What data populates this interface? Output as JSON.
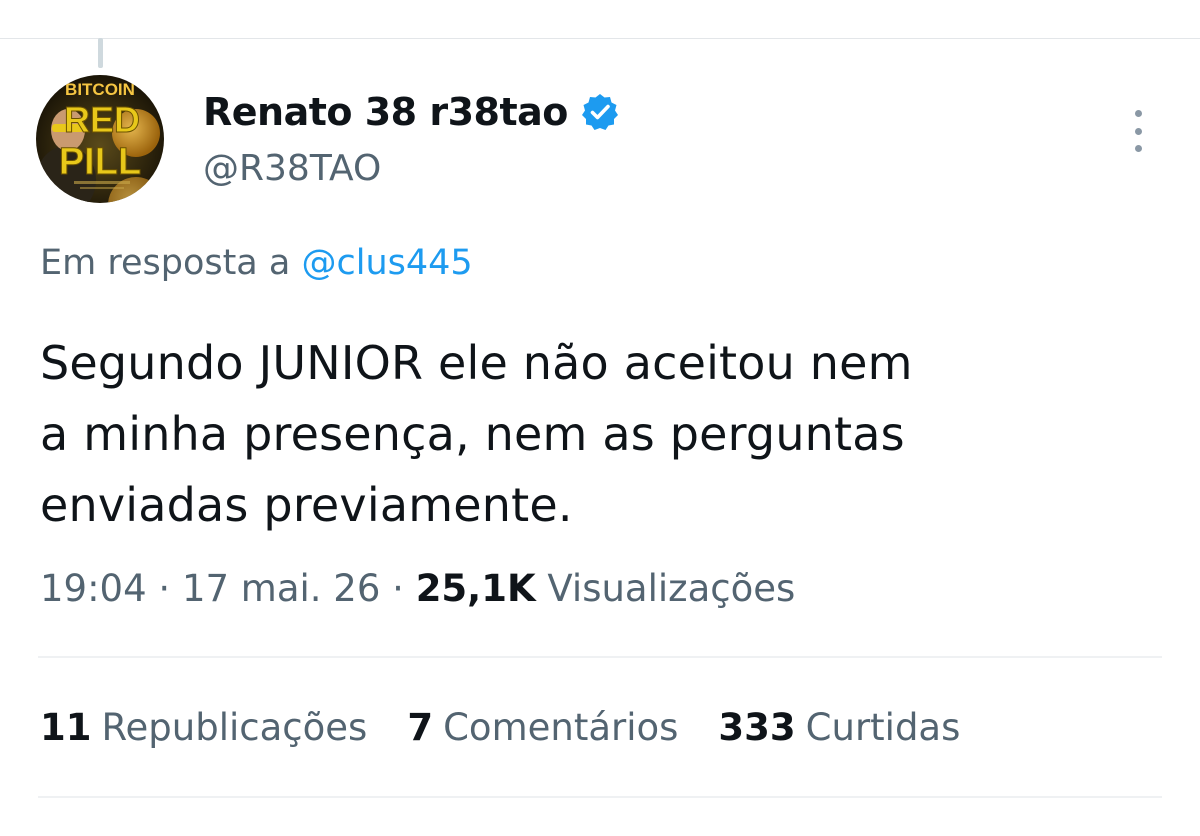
{
  "author": {
    "display_name": "Renato 38 r38tao",
    "handle": "@R38TAO",
    "verified": true,
    "avatar_text": [
      "BITCOIN",
      "RED",
      "PILL"
    ]
  },
  "more_icon": "more-vertical-icon",
  "reply": {
    "prefix": "Em resposta a",
    "mention": "@clus445"
  },
  "tweet": {
    "lines": [
      "Segundo JUNIOR ele não aceitou nem",
      "a minha presença, nem as perguntas",
      "enviadas previamente."
    ]
  },
  "meta": {
    "time": "19:04",
    "sep1": "·",
    "date": "17 mai. 26",
    "sep2": "·",
    "views_count": "25,1K",
    "views_label": "Visualizações"
  },
  "stats": {
    "reposts_count": "11",
    "reposts_label": "Republicações",
    "comments_count": "7",
    "comments_label": "Comentários",
    "likes_count": "333",
    "likes_label": "Curtidas"
  },
  "colors": {
    "link": "#1d9bf0",
    "secondary": "#536471",
    "primary": "#0f1419",
    "verified": "#1d9bf0"
  }
}
